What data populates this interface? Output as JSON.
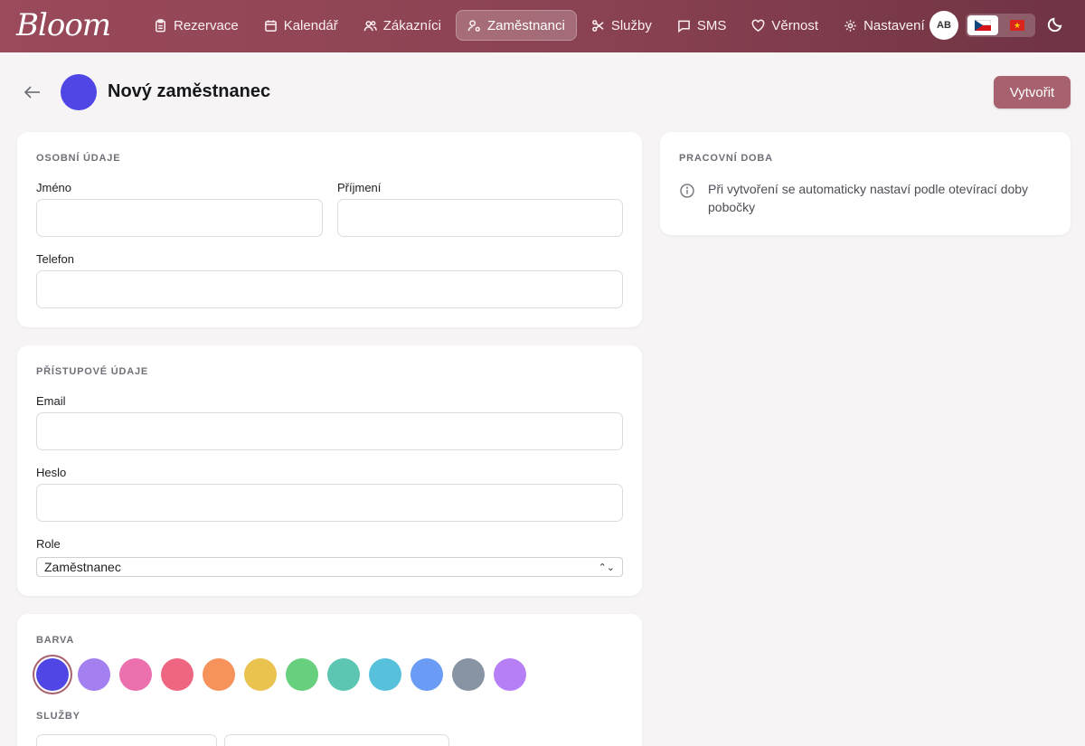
{
  "app": {
    "logo_text": "Bloom"
  },
  "nav": {
    "items": [
      {
        "label": "Rezervace",
        "icon": "clipboard-icon"
      },
      {
        "label": "Kalendář",
        "icon": "calendar-icon"
      },
      {
        "label": "Zákazníci",
        "icon": "users-icon"
      },
      {
        "label": "Zaměstnanci",
        "icon": "user-cog-icon",
        "active": true
      },
      {
        "label": "Služby",
        "icon": "scissors-icon"
      },
      {
        "label": "SMS",
        "icon": "message-icon"
      },
      {
        "label": "Věrnost",
        "icon": "heart-icon"
      },
      {
        "label": "Nastavení",
        "icon": "gear-icon"
      }
    ],
    "avatar_initials": "AB",
    "languages": [
      "cz-flag",
      "vn-flag"
    ],
    "theme_toggle_icon": "moon-icon"
  },
  "header": {
    "title": "Nový zaměstnanec",
    "create_button": "Vytvořit",
    "avatar_color": "#4f46e5"
  },
  "personal": {
    "section_title": "OSOBNÍ ÚDAJE",
    "first_name_label": "Jméno",
    "first_name_value": "",
    "last_name_label": "Příjmení",
    "last_name_value": "",
    "phone_label": "Telefon",
    "phone_value": ""
  },
  "access": {
    "section_title": "PŘÍSTUPOVÉ ÚDAJE",
    "email_label": "Email",
    "email_value": "",
    "password_label": "Heslo",
    "password_value": "",
    "role_label": "Role",
    "role_value": "Zaměstnanec"
  },
  "color": {
    "section_title": "BARVA",
    "swatches": [
      "#4f46e5",
      "#a47ff0",
      "#ec6fae",
      "#ef6682",
      "#f6935a",
      "#e9c24f",
      "#66d07f",
      "#5cc6b3",
      "#57c1dc",
      "#6b9cf5",
      "#8893a3",
      "#b77ff5"
    ],
    "selected_index": 0
  },
  "services": {
    "section_title": "SLUŽBY"
  },
  "work_hours": {
    "section_title": "PRACOVNÍ DOBA",
    "info_text": "Při vytvoření se automaticky nastaví podle otevírací doby pobočky"
  },
  "colors": {
    "brand": "#9a4a5a",
    "button": "#a8616f"
  }
}
